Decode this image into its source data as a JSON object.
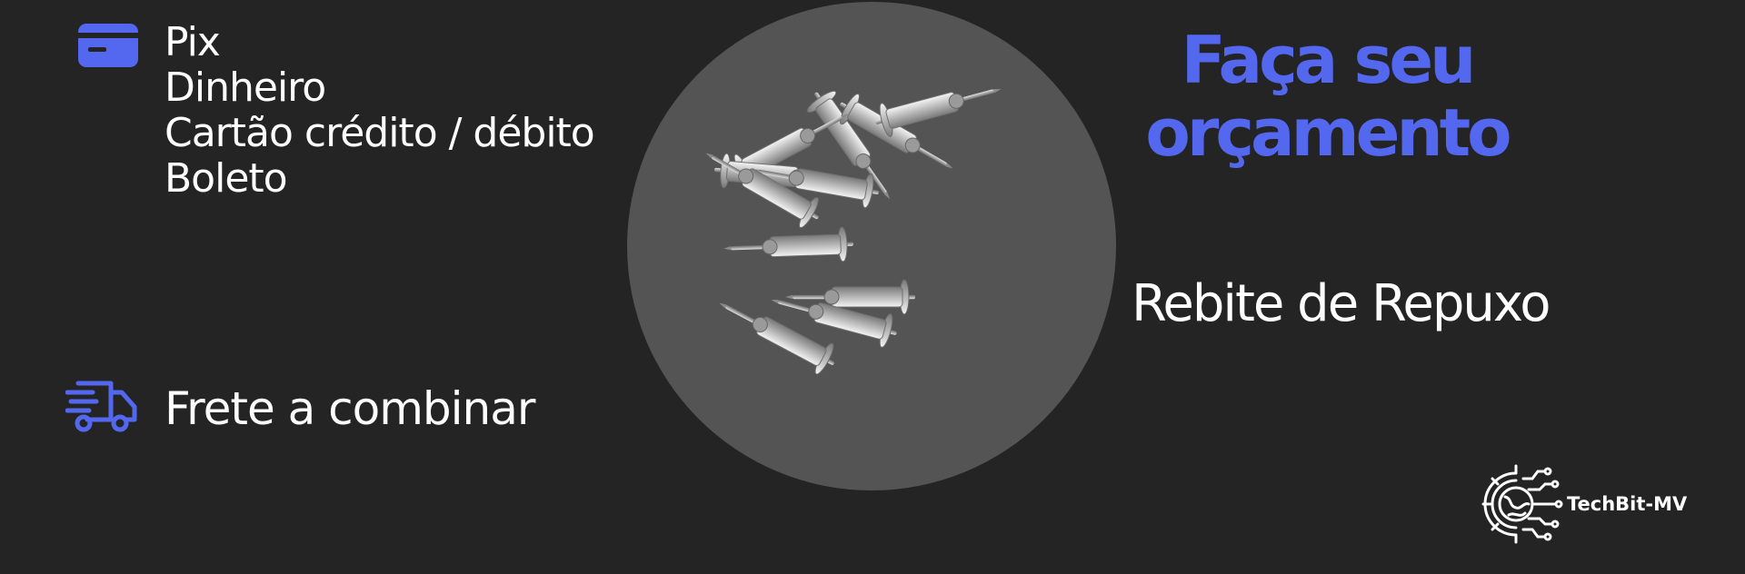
{
  "payment": {
    "icon": "credit-card-icon",
    "methods": [
      "Pix",
      "Dinheiro",
      "Cartão crédito / débito",
      "Boleto"
    ]
  },
  "shipping": {
    "icon": "delivery-truck-icon",
    "label": "Frete a combinar"
  },
  "headline": {
    "line1": "Faça seu",
    "line2": "orçamento"
  },
  "product": {
    "name": "Rebite de Repuxo",
    "image": "pop-rivets-photo"
  },
  "brand": {
    "name": "TechBit-MV",
    "icon": "gear-circuit-logo-icon"
  },
  "colors": {
    "background": "#242425",
    "accent": "#5468ef",
    "circle": "#545454",
    "text": "#ffffff"
  }
}
